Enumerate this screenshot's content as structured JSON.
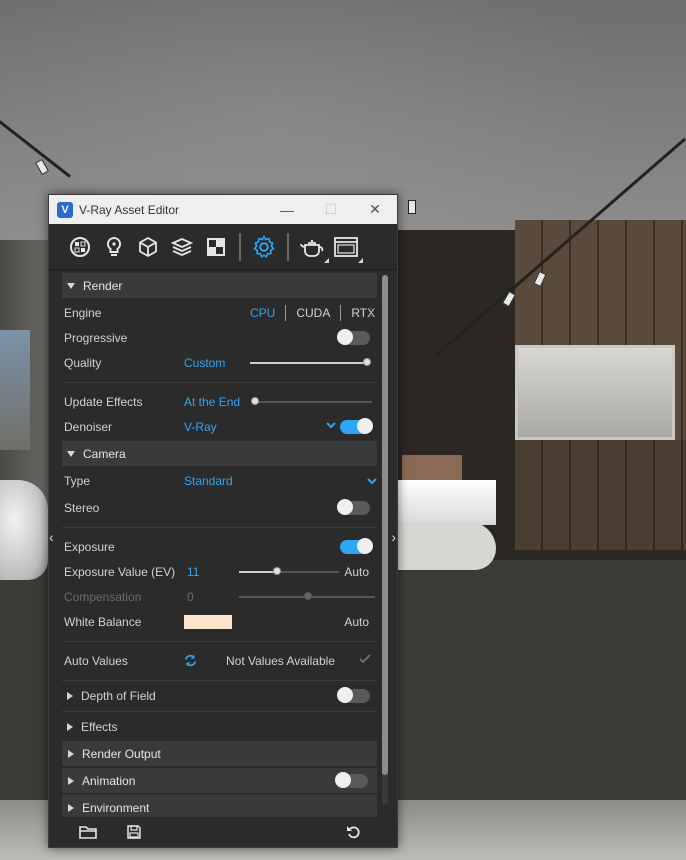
{
  "window": {
    "title": "V-Ray Asset Editor",
    "logo_letter": "V",
    "minimize_glyph": "—",
    "maximize_glyph": "☐",
    "close_glyph": "✕"
  },
  "toolbar": {
    "icons": [
      "materials-icon",
      "lights-icon",
      "geometry-icon",
      "layers-icon",
      "textures-icon",
      "settings-icon",
      "render-teapot-icon",
      "frame-buffer-icon"
    ],
    "active": "settings-icon",
    "accent": "#2ea6f5"
  },
  "render": {
    "header": "Render",
    "engine_label": "Engine",
    "engine_options": [
      "CPU",
      "CUDA",
      "RTX"
    ],
    "engine_selected": "CPU",
    "progressive_label": "Progressive",
    "progressive_on": false,
    "quality_label": "Quality",
    "quality_value": "Custom",
    "quality_level": 1.0,
    "update_effects_label": "Update Effects",
    "update_effects_value": "At the End",
    "update_effects_level": 0.0,
    "denoiser_label": "Denoiser",
    "denoiser_value": "V-Ray",
    "denoiser_on": true
  },
  "camera": {
    "header": "Camera",
    "type_label": "Type",
    "type_value": "Standard",
    "stereo_label": "Stereo",
    "stereo_on": false,
    "exposure_label": "Exposure",
    "exposure_on": true,
    "exposure_value_label": "Exposure Value (EV)",
    "exposure_value": "11",
    "exposure_auto": "Auto",
    "compensation_label": "Compensation",
    "compensation_value": "0",
    "white_balance_label": "White Balance",
    "white_balance_color": "#ffe4cc",
    "white_balance_auto": "Auto",
    "auto_values_label": "Auto Values",
    "auto_values_status": "Not Values Available"
  },
  "collapsed_sections": {
    "depth_of_field": "Depth of Field",
    "effects": "Effects",
    "render_output": "Render Output",
    "animation": "Animation",
    "environment": "Environment"
  },
  "bottombar": {
    "icons": [
      "open-folder-icon",
      "save-icon",
      "revert-icon"
    ]
  }
}
